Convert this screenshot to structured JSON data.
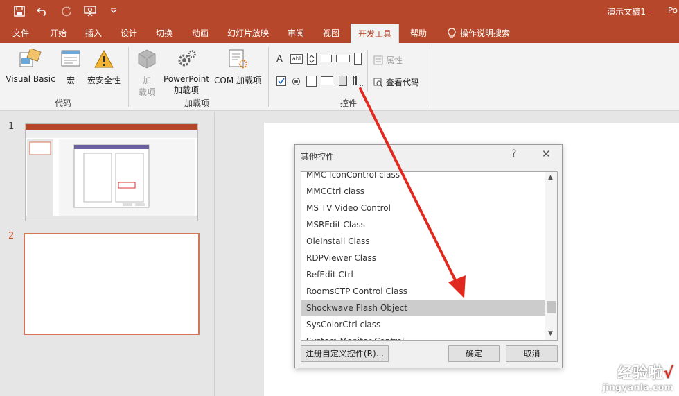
{
  "titlebar": {
    "doc_title": "演示文稿1",
    "dash": "-",
    "app_cut": "Po"
  },
  "qat": {
    "icons": [
      "save-icon",
      "undo-icon",
      "redo-icon",
      "slideshow-icon",
      "customize-icon"
    ]
  },
  "tabs": [
    "文件",
    "开始",
    "插入",
    "设计",
    "切换",
    "动画",
    "幻灯片放映",
    "审阅",
    "视图",
    "开发工具",
    "帮助",
    "操作说明搜索"
  ],
  "active_tab": "开发工具",
  "ribbon": {
    "code_group": {
      "label": "代码",
      "visual_basic": "Visual Basic",
      "macro": "宏",
      "macro_security": "宏安全性"
    },
    "addins_group": {
      "label": "加载项",
      "addins_line1": "加",
      "addins_line2": "载项",
      "ppt_addins_line1": "PowerPoint",
      "ppt_addins_line2": "加载项",
      "com_addins": "COM 加载项"
    },
    "controls_group": {
      "label": "控件",
      "properties": "属性",
      "view_code": "查看代码"
    }
  },
  "slides": {
    "numbers": [
      "1",
      "2"
    ]
  },
  "dialog": {
    "title": "其他控件",
    "help": "?",
    "close": "✕",
    "items": [
      "MMC IconControl class",
      "MMCCtrl class",
      "MS TV Video Control",
      "MSREdit Class",
      "OleInstall Class",
      "RDPViewer Class",
      "RefEdit.Ctrl",
      "RoomsCTP Control Class",
      "Shockwave Flash Object",
      "SysColorCtrl class",
      "System Monitor Control"
    ],
    "selected_item": "Shockwave Flash Object",
    "register_button": "注册自定义控件(R)...",
    "ok_button": "确定",
    "cancel_button": "取消"
  },
  "watermark": {
    "line1": "经验啦",
    "check": "√",
    "line2": "jingyanla.com"
  },
  "colors": {
    "accent": "#b7472a",
    "arrow": "#e02a20",
    "selection": "#cccccc"
  }
}
